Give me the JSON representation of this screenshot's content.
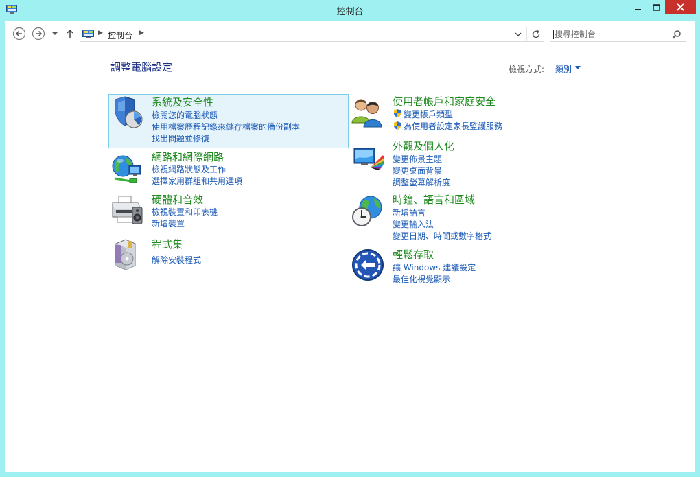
{
  "window": {
    "title": "控制台"
  },
  "address": {
    "crumb": "控制台"
  },
  "search": {
    "placeholder": "搜尋控制台"
  },
  "page": {
    "title": "調整電腦設定",
    "view_label": "檢視方式:",
    "view_value": "類別"
  },
  "categories_left": [
    {
      "title": "系統及安全性",
      "icon": "security-shield-icon",
      "links": [
        "檢閱您的電腦狀態",
        "使用檔案歷程記錄來儲存檔案的備份副本",
        "找出問題並修復"
      ]
    },
    {
      "title": "網路和網際網路",
      "icon": "network-globe-icon",
      "links": [
        "檢視網路狀態及工作",
        "選擇家用群組和共用選項"
      ]
    },
    {
      "title": "硬體和音效",
      "icon": "printer-icon",
      "links": [
        "檢視裝置和印表機",
        "新增裝置"
      ]
    },
    {
      "title": "程式集",
      "icon": "programs-box-icon",
      "links": [
        "解除安裝程式"
      ]
    }
  ],
  "categories_right": [
    {
      "title": "使用者帳戶和家庭安全",
      "icon": "users-icon",
      "links": [
        "變更帳戶類型",
        "為使用者設定家長監護服務"
      ]
    },
    {
      "title": "外觀及個人化",
      "icon": "display-color-icon",
      "links": [
        "變更佈景主題",
        "變更桌面背景",
        "調整螢幕解析度"
      ]
    },
    {
      "title": "時鐘、語言和區域",
      "icon": "clock-globe-icon",
      "links": [
        "新增語言",
        "變更輸入法",
        "變更日期、時間或數字格式"
      ]
    },
    {
      "title": "輕鬆存取",
      "icon": "ease-of-access-icon",
      "links": [
        "讓 Windows 建議設定",
        "最佳化視覺顯示"
      ]
    }
  ],
  "colors": {
    "frame": "#9ff0f0",
    "close_button": "#c7302b",
    "category_title": "#1e8a1e",
    "link": "#1c5bb6",
    "page_title": "#1e3287",
    "selection_bg": "#e5f3fb",
    "selection_border": "#7ccdeb"
  }
}
